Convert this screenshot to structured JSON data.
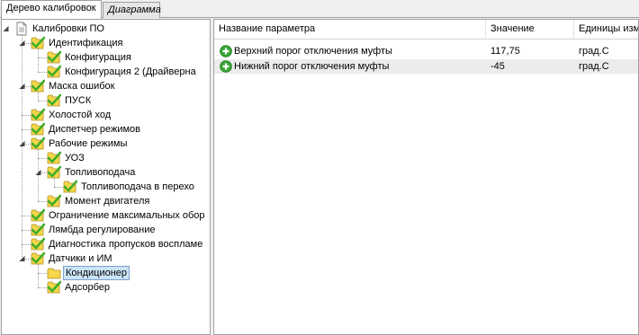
{
  "tabs": [
    {
      "label": "Дерево калибровок",
      "active": true
    },
    {
      "label": "Диаграмма",
      "active": false
    }
  ],
  "tree": {
    "root": "Калибровки ПО",
    "items": [
      {
        "label": "Идентификация",
        "expander": "◢"
      },
      {
        "label": "Конфигурация"
      },
      {
        "label": "Конфигурация 2 (Драйверна"
      },
      {
        "label": "Маска ошибок",
        "expander": "◢"
      },
      {
        "label": "ПУСК"
      },
      {
        "label": "Холостой ход"
      },
      {
        "label": "Диспетчер режимов"
      },
      {
        "label": "Рабочие режимы",
        "expander": "◢"
      },
      {
        "label": "УОЗ"
      },
      {
        "label": "Топливоподача",
        "expander": "◢"
      },
      {
        "label": "Топливоподача в перехо"
      },
      {
        "label": "Момент двигателя"
      },
      {
        "label": "Ограничение максимальных обор"
      },
      {
        "label": "Лямбда регулирование"
      },
      {
        "label": "Диагностика пропусков воспламе"
      },
      {
        "label": "Датчики и ИМ",
        "expander": "◢"
      },
      {
        "label": "Кондиционер",
        "selected": true
      },
      {
        "label": "Адсорбер"
      }
    ],
    "root_expander": "◢"
  },
  "table": {
    "columns": [
      "Название параметра",
      "Значение",
      "Единицы измер"
    ],
    "rows": [
      {
        "name": "Верхний порог отключения муфты",
        "value": "117,75",
        "unit": "град.С"
      },
      {
        "name": "Нижний порог отключения муфты",
        "value": "-45",
        "unit": "град.С"
      }
    ]
  },
  "colors": {
    "check": "#3fae2a",
    "folder": "#f6d64a",
    "selection": "#cce4f7",
    "plus": "#37a735"
  },
  "icons": {
    "tree_item": "checked-folder-icon",
    "root": "document-icon",
    "selected": "folder-icon",
    "row": "plus-circle-icon"
  }
}
